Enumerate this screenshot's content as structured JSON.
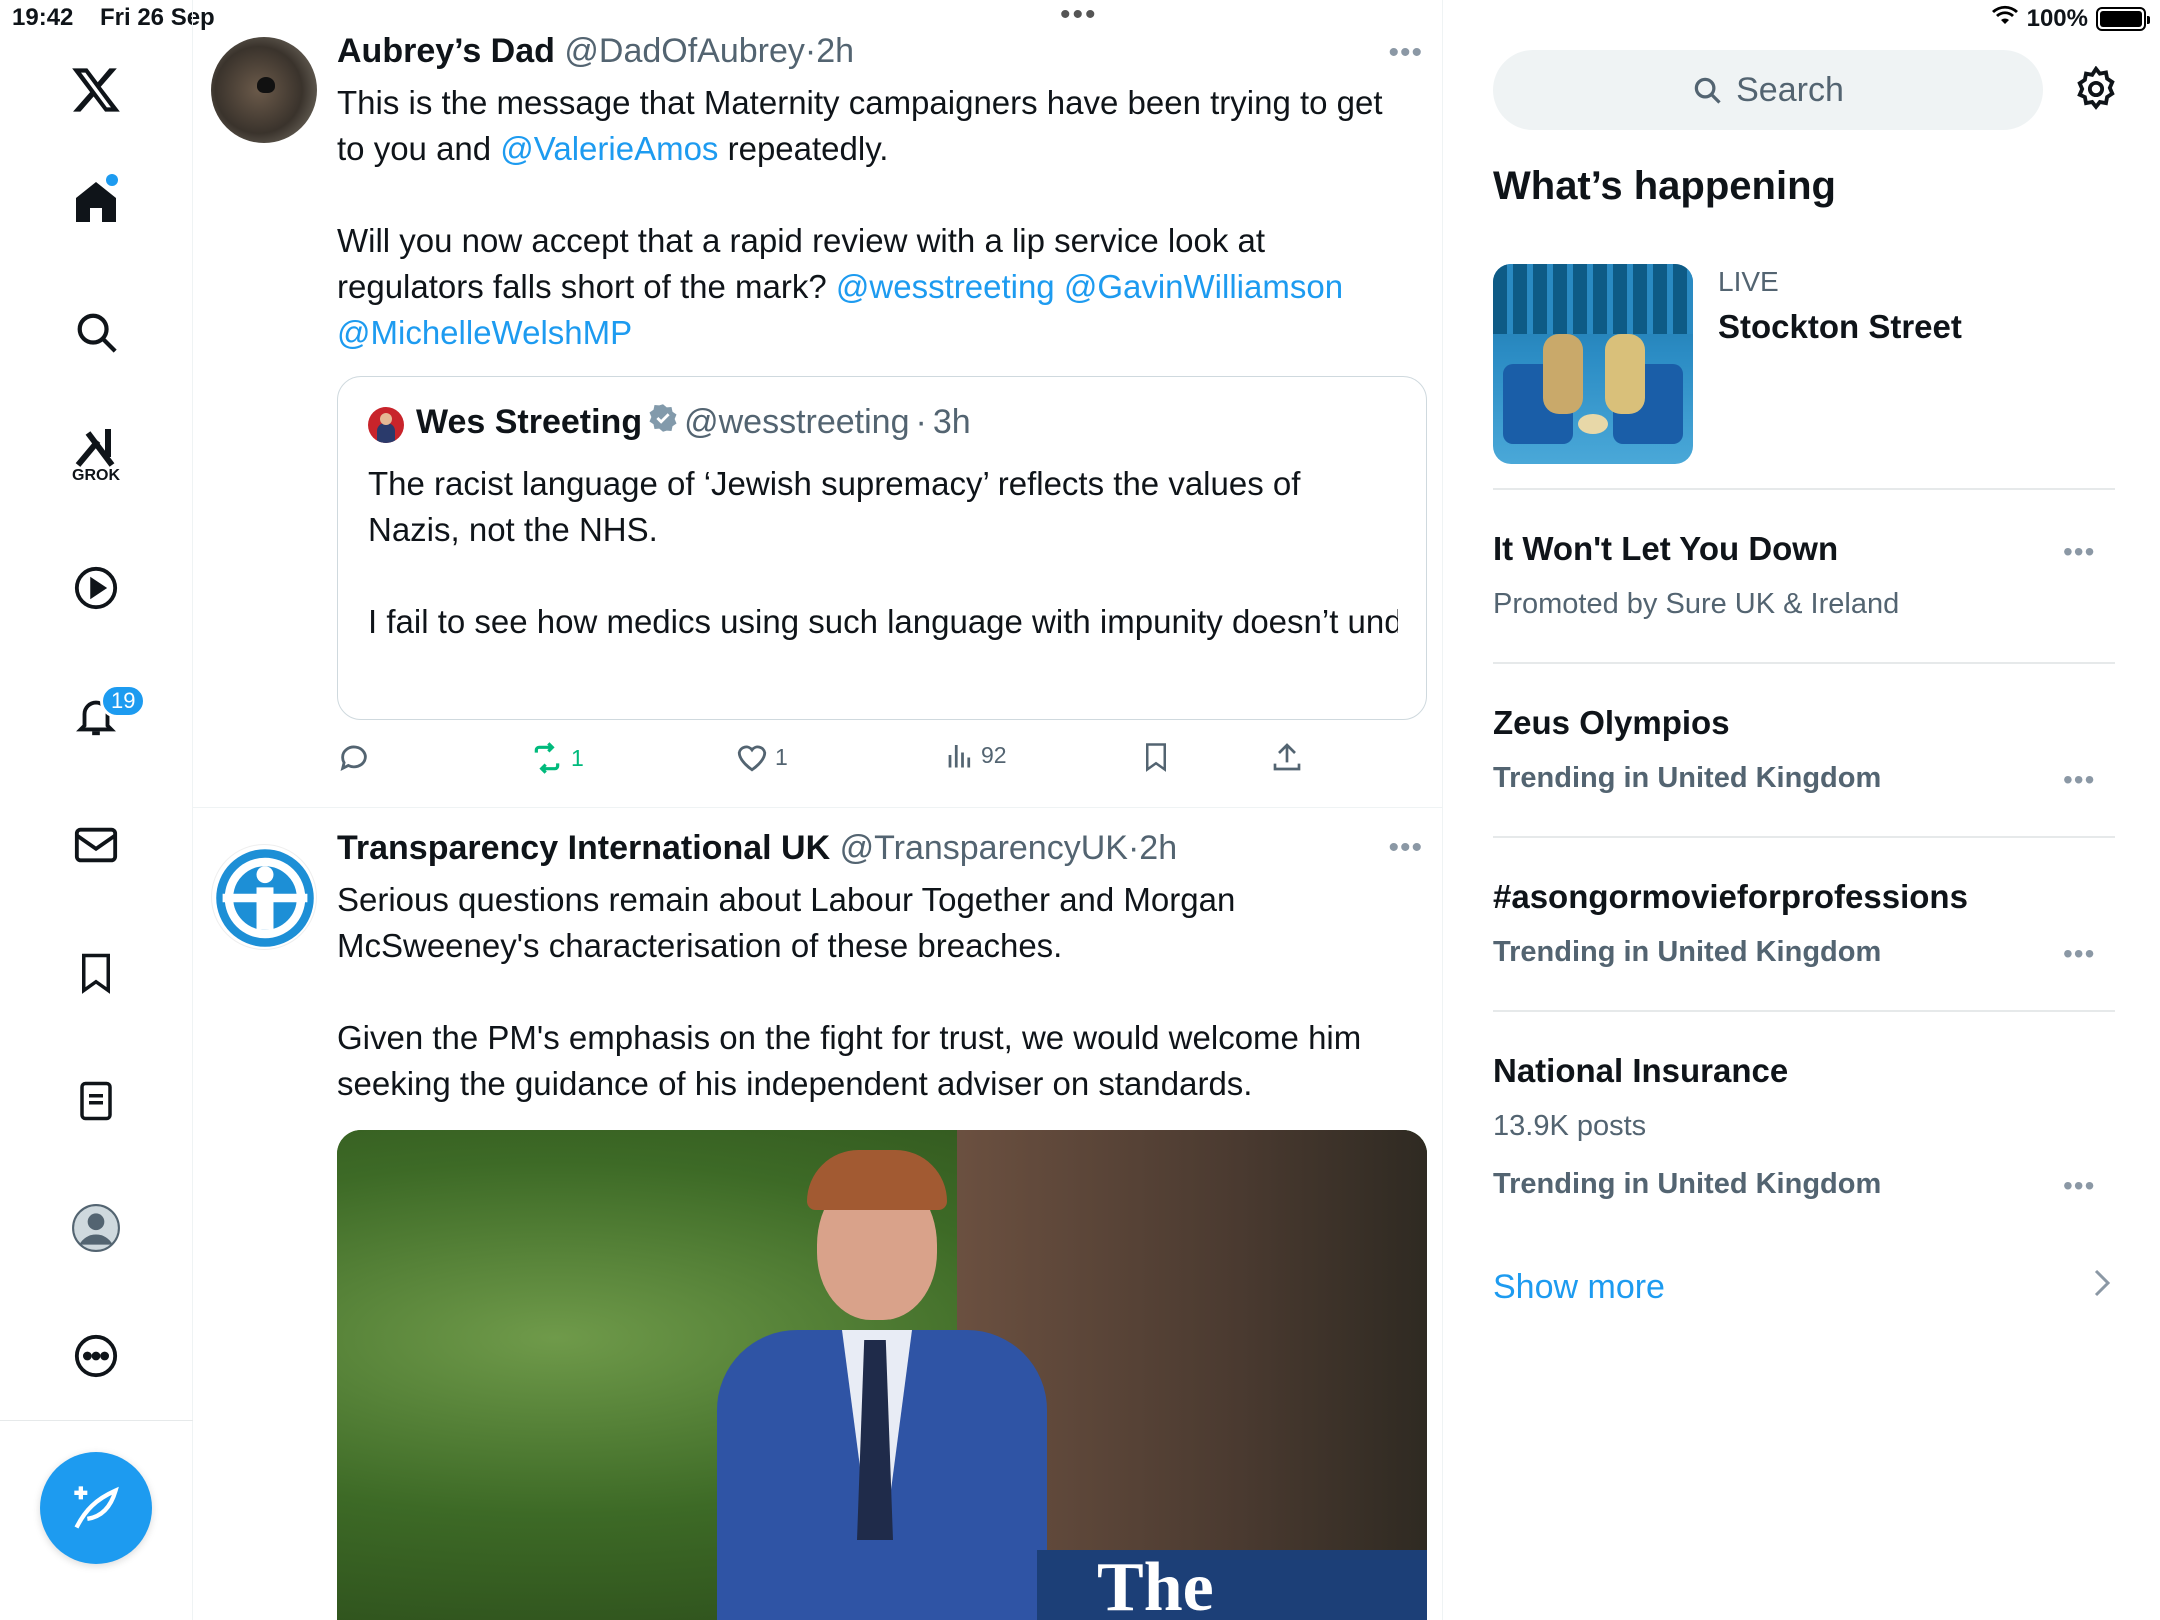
{
  "status_bar": {
    "time": "19:42",
    "date": "Fri 26 Sep",
    "battery": "100%",
    "battery_level": 1.0
  },
  "nav": {
    "grok_label": "GROK",
    "notifications_badge": "19"
  },
  "tweets": [
    {
      "name": "Aubrey’s Dad",
      "handle": "@DadOfAubrey",
      "sep": "·",
      "time": "2h",
      "text1": "This is the message that Maternity campaigners have been trying to get to you and ",
      "mention1": "@ValerieAmos",
      "text1b": " repeatedly.",
      "text2": "Will you now accept that a rapid review with a lip service look at regulators falls short of the mark? ",
      "mention2": "@wesstreeting",
      "mention3": "@GavinWilliamson",
      "mention4": "@MichelleWelshMP",
      "quote": {
        "name": "Wes Streeting",
        "handle": "@wesstreeting",
        "sep": "·",
        "time": "3h",
        "text1": "The racist language of ‘Jewish supremacy’ reflects the values of Nazis, not the NHS.",
        "text2": "I fail to see how medics using such language with impunity doesn’t undermine confidence in the medical profession. I have no confid..."
      },
      "retweets": "1",
      "likes": "1",
      "views": "92"
    },
    {
      "name": "Transparency International UK",
      "handle": "@TransparencyUK",
      "sep": "·",
      "time": "2h",
      "text1": "Serious questions remain about Labour Together and Morgan McSweeney's characterisation of these breaches.",
      "text2": "Given the PM's emphasis on the fight for trust, we would welcome him seeking the guidance of his independent adviser on standards.",
      "media_text": "The"
    }
  ],
  "sidebar": {
    "search_placeholder": "Search",
    "section_title": "What’s happening",
    "live": {
      "label": "LIVE",
      "title": "Stockton Street"
    },
    "trends": [
      {
        "title": "It Won't Let You Down",
        "sub": "Promoted by Sure UK & Ireland"
      },
      {
        "title": "Zeus Olympios",
        "context": "Trending in United Kingdom"
      },
      {
        "title": "#asongormovieforprofessions",
        "context": "Trending in United Kingdom"
      },
      {
        "title": "National Insurance",
        "sub": "13.9K posts",
        "context": "Trending in United Kingdom"
      }
    ],
    "show_more": "Show more"
  },
  "colors": {
    "accent": "#1d9bf0",
    "retweet_green": "#00ba7c",
    "secondary_text": "#536471"
  }
}
